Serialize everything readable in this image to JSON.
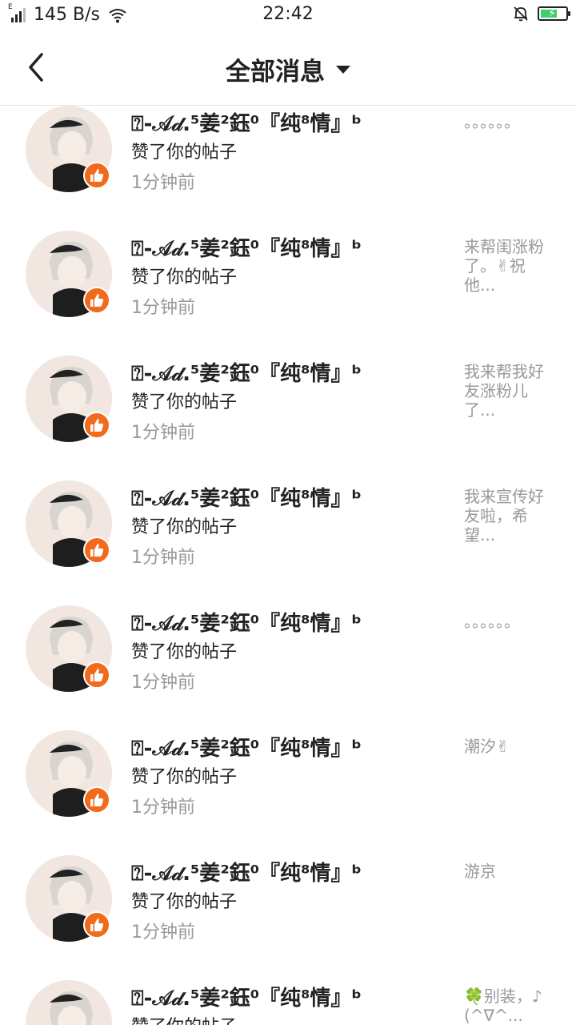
{
  "status_bar": {
    "network_type": "E",
    "speed": "145 B/s",
    "time": "22:42"
  },
  "header": {
    "title": "全部消息",
    "back_icon": "chevron-left-icon",
    "dropdown_icon": "caret-down-icon"
  },
  "colors": {
    "badge": "#f26a1b",
    "secondary_text": "#999999",
    "battery": "#3ccf6a"
  },
  "messages": [
    {
      "name": "⍰-𝒜𝒹.⁵姜²鈺⁰『纯⁸情』ᵇ",
      "action": "赞了你的帖子",
      "time": "1分钟前",
      "preview": "。。。。。。"
    },
    {
      "name": "⍰-𝒜𝒹.⁵姜²鈺⁰『纯⁸情』ᵇ",
      "action": "赞了你的帖子",
      "time": "1分钟前",
      "preview": "来帮闺涨粉了。✌祝他..."
    },
    {
      "name": "⍰-𝒜𝒹.⁵姜²鈺⁰『纯⁸情』ᵇ",
      "action": "赞了你的帖子",
      "time": "1分钟前",
      "preview": "我来帮我好友涨粉儿了..."
    },
    {
      "name": "⍰-𝒜𝒹.⁵姜²鈺⁰『纯⁸情』ᵇ",
      "action": "赞了你的帖子",
      "time": "1分钟前",
      "preview": "我来宣传好友啦，希望..."
    },
    {
      "name": "⍰-𝒜𝒹.⁵姜²鈺⁰『纯⁸情』ᵇ",
      "action": "赞了你的帖子",
      "time": "1分钟前",
      "preview": "。。。。。。"
    },
    {
      "name": "⍰-𝒜𝒹.⁵姜²鈺⁰『纯⁸情』ᵇ",
      "action": "赞了你的帖子",
      "time": "1分钟前",
      "preview": "潮汐✌"
    },
    {
      "name": "⍰-𝒜𝒹.⁵姜²鈺⁰『纯⁸情』ᵇ",
      "action": "赞了你的帖子",
      "time": "1分钟前",
      "preview": "游京"
    },
    {
      "name": "⍰-𝒜𝒹.⁵姜²鈺⁰『纯⁸情』ᵇ",
      "action": "赞了你的帖子",
      "time": "",
      "preview": "🍀别装，♪(^∇^..."
    }
  ]
}
